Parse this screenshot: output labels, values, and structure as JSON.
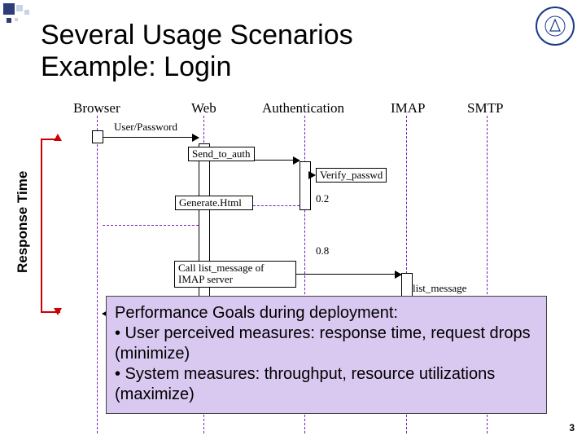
{
  "title_line1": "Several Usage Scenarios",
  "title_line2": "Example: Login",
  "lanes": {
    "browser": "Browser",
    "web": "Web",
    "auth": "Authentication",
    "imap": "IMAP",
    "smtp": "SMTP"
  },
  "messages": {
    "user_password": "User/Password",
    "send_to_auth": "Send_to_auth",
    "verify_passwd": "Verify_passwd",
    "generate_html": "Generate.Html",
    "call_list_message": "Call list_message of IMAP server",
    "list_message": "list_message"
  },
  "values": {
    "v02": "0.2",
    "v08": "0.8"
  },
  "axis": {
    "response_time": "Response Time"
  },
  "overlay": {
    "l1": "Performance Goals during deployment:",
    "l2": "• User perceived measures: response time, request drops  (minimize)",
    "l3": "• System measures: throughput, resource utilizations (maximize)"
  },
  "slide_number": "3",
  "chart_data": {
    "type": "table",
    "description": "UML-style sequence diagram for a Login scenario across five lifelines with message labels and two numeric annotations (0.2, 0.8). A red bracket on the left denotes Response Time span.",
    "lifelines": [
      "Browser",
      "Web",
      "Authentication",
      "IMAP",
      "SMTP"
    ],
    "interactions": [
      {
        "from": "Browser",
        "to": "Web",
        "label": "User/Password",
        "style": "solid"
      },
      {
        "from": "Web",
        "to": "Authentication",
        "label": "Send_to_auth",
        "style": "solid"
      },
      {
        "from": "Authentication",
        "to": "Authentication",
        "label": "Verify_passwd",
        "style": "solid"
      },
      {
        "from": "Authentication",
        "to": "Web",
        "label": "0.2",
        "style": "dashed-return"
      },
      {
        "from": "Web",
        "to": "Web",
        "label": "Generate.Html",
        "style": "self"
      },
      {
        "from": "Web",
        "to": "IMAP",
        "label": "Call list_message of IMAP server",
        "annotation": "0.8",
        "style": "solid"
      },
      {
        "from": "IMAP",
        "to": "IMAP",
        "label": "list_message",
        "style": "self"
      },
      {
        "from": "IMAP",
        "to": "Web",
        "label": "",
        "style": "dashed-return"
      },
      {
        "from": "Web",
        "to": "Browser",
        "label": "",
        "style": "dashed-return"
      }
    ],
    "annotations": [
      {
        "text": "Response Time",
        "role": "bracket-left"
      }
    ],
    "overlay_box": [
      "Performance Goals during deployment:",
      "• User perceived measures: response time, request drops  (minimize)",
      "• System measures: throughput, resource utilizations (maximize)"
    ]
  }
}
